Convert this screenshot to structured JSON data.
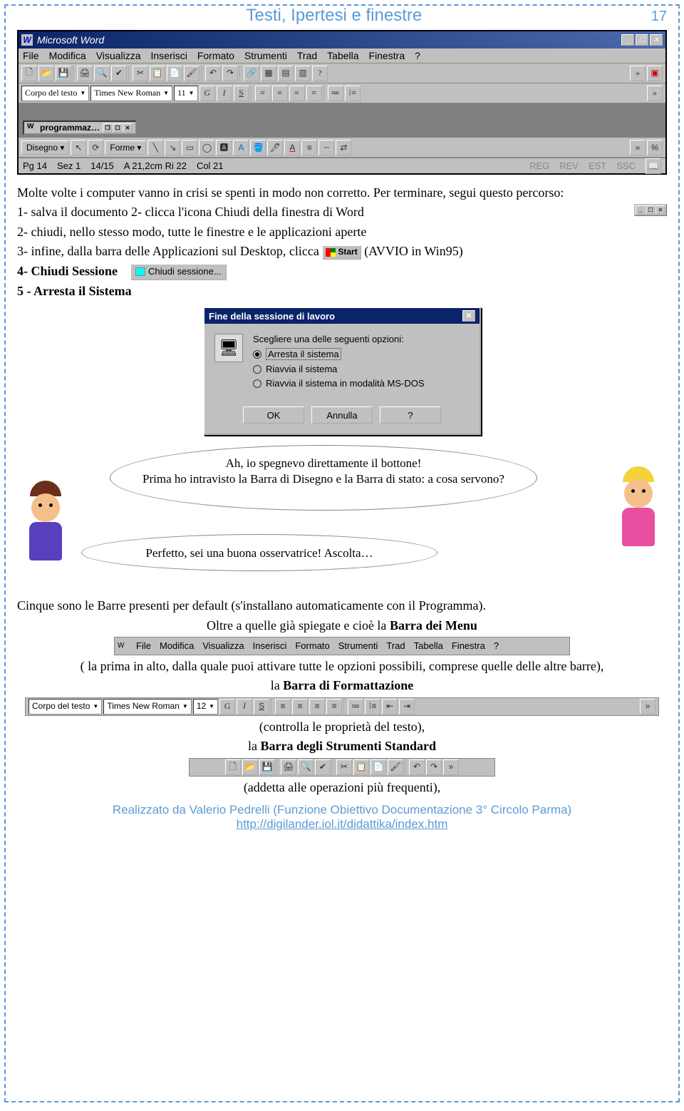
{
  "header": {
    "title": "Testi, Ipertesi e finestre",
    "page": "17"
  },
  "word_window": {
    "title": "Microsoft Word",
    "menus": [
      "File",
      "Modifica",
      "Visualizza",
      "Inserisci",
      "Formato",
      "Strumenti",
      "Trad",
      "Tabella",
      "Finestra",
      "?"
    ],
    "font_style_combo": "Corpo del testo",
    "font_combo": "Times New Roman",
    "size_combo": "11",
    "taskbar_button": "programmaz…",
    "draw_label": "Disegno",
    "forme_label": "Forme",
    "status": {
      "pg": "Pg 14",
      "sez": "Sez 1",
      "page_of": "14/15",
      "ruler": "A 21,2cm Ri 22",
      "col": "Col 21",
      "reg": "REG",
      "rev": "REV",
      "est": "EST",
      "ssc": "SSC"
    }
  },
  "prose": {
    "intro": "Molte volte i computer vanno in crisi se spenti in modo non corretto. Per terminare, segui questo percorso:",
    "step1": "1-  salva il documento  2- clicca l'icona Chiudi della finestra di Word",
    "step2": "2-  chiudi, nello stesso modo, tutte le finestre e le applicazioni aperte",
    "step3_a": "3-  infine, dalla barra delle Applicazioni sul Desktop, clicca",
    "start_label": "Start",
    "step3_b": "(AVVIO in Win95)",
    "step4_a": "4-  Chiudi Sessione",
    "chiudi_sess_label": "Chiudi sessione...",
    "step5": "5 -  Arresta il Sistema"
  },
  "dialog": {
    "title": "Fine della sessione di lavoro",
    "prompt": "Scegliere una delle seguenti opzioni:",
    "opt1": "Arresta il sistema",
    "opt2": "Riavvia il sistema",
    "opt3": "Riavvia il sistema in modalità MS-DOS",
    "ok": "OK",
    "cancel": "Annulla",
    "help": "?"
  },
  "bubbles": {
    "b1_l1": "Ah, io spegnevo direttamente il bottone!",
    "b1_l2": "Prima ho intravisto la Barra di Disegno e la Barra di  stato: a cosa servono?",
    "b2": "Perfetto, sei una buona osservatrice! Ascolta…"
  },
  "lower": {
    "p1": "Cinque sono le Barre presenti per default (s'installano automaticamente con il Programma).",
    "p2a": "Oltre a quelle già spiegate e cioè la ",
    "p2b": "Barra dei Menu",
    "p3": "( la prima in alto, dalla quale puoi attivare tutte le opzioni possibili, comprese quelle delle altre barre),",
    "p4a": "la ",
    "p4b": "Barra di Formattazione",
    "p5": "(controlla le proprietà del testo),",
    "p6a": "la ",
    "p6b": "Barra degli Strumenti Standard",
    "p7": "(addetta alle operazioni più frequenti),"
  },
  "barra_menu_strip": {
    "items": [
      "File",
      "Modifica",
      "Visualizza",
      "Inserisci",
      "Formato",
      "Strumenti",
      "Trad",
      "Tabella",
      "Finestra",
      "?"
    ]
  },
  "barra_format": {
    "style_combo": "Corpo del testo",
    "font_combo": "Times New Roman",
    "size_combo": "12"
  },
  "footer": {
    "line1": "Realizzato da Valerio Pedrelli (Funzione Obiettivo Documentazione 3° Circolo Parma)",
    "link": "http://digilander.iol.it/didattika/index.htm"
  }
}
